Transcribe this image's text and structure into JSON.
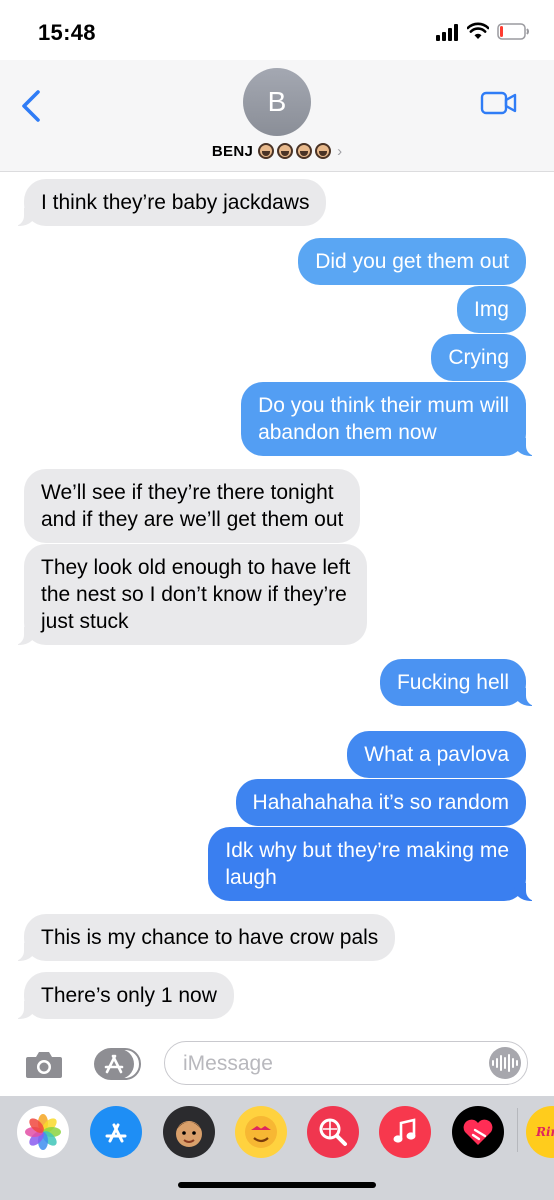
{
  "status_bar": {
    "time": "15:48",
    "icons": [
      "signal-icon",
      "wifi-icon",
      "battery-icon"
    ]
  },
  "header": {
    "avatar_initial": "B",
    "contact_name": "BENJ",
    "name_emojis": [
      "man-beard-emoji",
      "man-beard-emoji",
      "man-beard-emoji",
      "man-beard-emoji"
    ],
    "icons": [
      "back-chevron-icon",
      "video-camera-icon"
    ]
  },
  "messages": [
    {
      "from": "them",
      "text": "I think they’re baby jackdaws"
    },
    {
      "from": "me",
      "text": "Did you get them out"
    },
    {
      "from": "me",
      "text": "Img"
    },
    {
      "from": "me",
      "text": "Crying"
    },
    {
      "from": "me",
      "text": "Do you think their mum will\nabandon them now"
    },
    {
      "from": "them",
      "text": "We’ll see if they’re there tonight\nand if they are we’ll get them out"
    },
    {
      "from": "them",
      "text": "They look old enough to have left\nthe nest so I don’t know if they’re\njust stuck"
    },
    {
      "from": "me",
      "text": "Fucking hell"
    },
    {
      "from": "me",
      "text": "What a pavlova"
    },
    {
      "from": "me",
      "text": "Hahahahaha it’s so random"
    },
    {
      "from": "me",
      "text": "Idk why but they’re making me\nlaugh"
    },
    {
      "from": "them",
      "text": "This is my chance to have crow pals"
    },
    {
      "from": "them",
      "text": "There’s only 1 now"
    }
  ],
  "colors": {
    "sent_light": "#5aa6f3",
    "sent_mid": "#4b93f2",
    "sent_dark": "#3a7ff0",
    "received": "#e9e9eb",
    "accent": "#2f7cf6"
  },
  "composer": {
    "placeholder": "iMessage",
    "icons": [
      "camera-icon",
      "app-store-icon",
      "audio-waveform-icon"
    ]
  },
  "app_drawer": {
    "apps": [
      "photos-icon",
      "app-store-icon",
      "memoji-icon",
      "animoji-stickers-icon",
      "web-search-icon",
      "music-icon",
      "digital-touch-icon",
      "ringtone-app-icon"
    ],
    "partial_app_label": "Rin"
  }
}
